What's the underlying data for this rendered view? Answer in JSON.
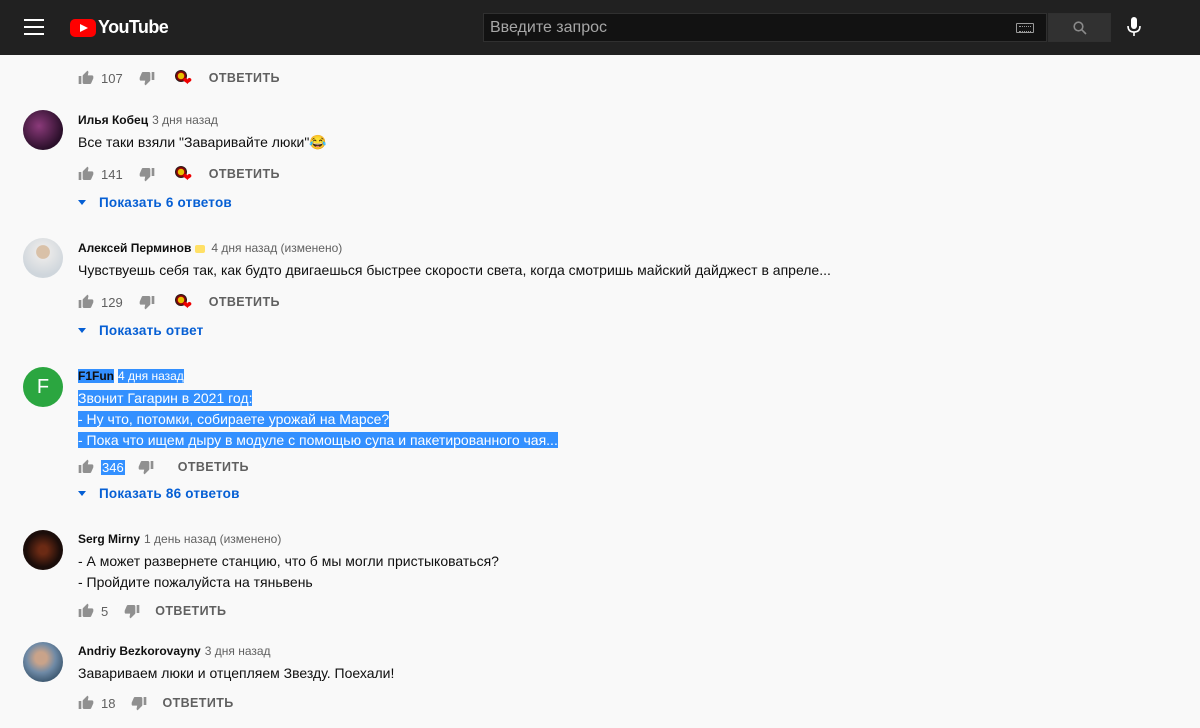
{
  "header": {
    "logo_text": "YouTube",
    "search_placeholder": "Введите запрос"
  },
  "top_actions": {
    "likes": "107",
    "reply_label": "ОТВЕТИТЬ"
  },
  "comments": [
    {
      "author": "Илья Кобец",
      "time": "3 дня назад",
      "text": [
        "Все таки взяли \"Заваривайте люки\"😂"
      ],
      "likes": "141",
      "reply_label": "ОТВЕТИТЬ",
      "replies_label": "Показать 6 ответов"
    },
    {
      "author": "Алексей Перминов",
      "time": "4 дня назад (изменено)",
      "text": [
        "Чувствуешь себя так, как будто двигаешься быстрее скорости света, когда смотришь майский дайджест в апреле..."
      ],
      "likes": "129",
      "reply_label": "ОТВЕТИТЬ",
      "replies_label": "Показать ответ"
    },
    {
      "author": "F1Fun",
      "time": "4 дня назад",
      "avatar_letter": "F",
      "text": [
        "Звонит Гагарин в 2021 год:",
        "- Ну что, потомки, собираете урожай на Марсе?",
        "- Пока что ищем дыру в модуле с помощью супа и пакетированного чая..."
      ],
      "likes": "346",
      "reply_label": "ОТВЕТИТЬ",
      "replies_label": "Показать 86 ответов"
    },
    {
      "author": "Serg Mirny",
      "time": "1 день назад (изменено)",
      "text": [
        "- А может развернете станцию, что б мы могли пристыковаться?",
        "- Пройдите пожалуйста на тяньвень"
      ],
      "likes": "5",
      "reply_label": "ОТВЕТИТЬ"
    },
    {
      "author": "Andriy Bezkorovayny",
      "time": "3 дня назад",
      "text": [
        "Завариваем люки и отцепляем Звезду. Поехали!"
      ],
      "likes": "18",
      "reply_label": "ОТВЕТИТЬ"
    }
  ],
  "colors": {
    "header_bg": "#212121",
    "link_blue": "#065fd4",
    "selection": "#3390ff",
    "f1fun_avatar": "#2ba640"
  }
}
